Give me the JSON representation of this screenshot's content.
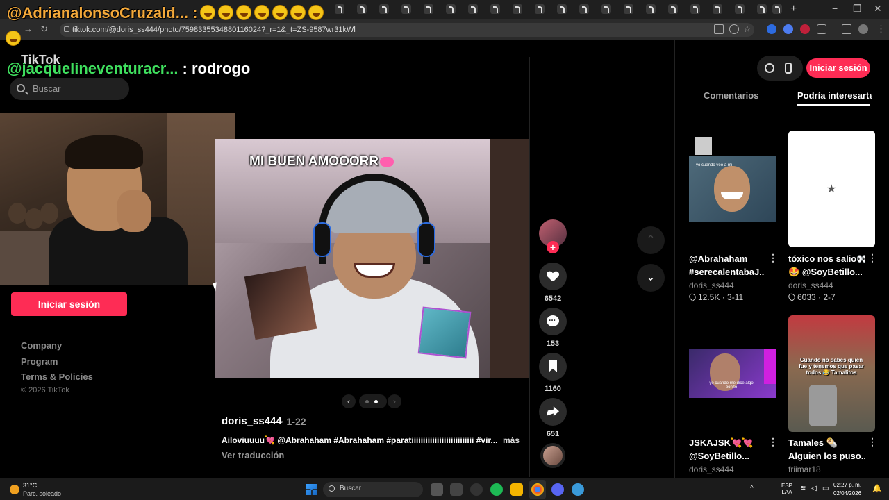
{
  "browser": {
    "url": "tiktok.com/@doris_ss444/photo/7598335534880116024?_r=1&_t=ZS-9587wr31kWl"
  },
  "stream_overlay": {
    "line1_user": "@AdrianalonsoCruzald... :",
    "line2_user": "@jacquelineventuracr...",
    "line2_msg": " : rodrogo"
  },
  "tiktok": {
    "logo": "TikTok",
    "search_placeholder": "Buscar",
    "login_label": "Iniciar sesión",
    "footer_links": [
      "Company",
      "Program",
      "Terms & Policies"
    ],
    "copyright": "© 2026 TikTok"
  },
  "post": {
    "image_caption": "MI BUEN AMOOORR",
    "author": "doris_ss444",
    "date": "· 1-22",
    "description": "Ailoviuuuu💘 @Abrahaham #Abrahaham #paratiiiiiiiiiiiiiiiiiiiiiiiiiii #vir...",
    "more_label": "más",
    "translate_label": "Ver traducción",
    "likes": "6542",
    "comments": "153",
    "saves": "1160",
    "shares": "651"
  },
  "right_panel": {
    "login_label": "Iniciar sesión",
    "tabs": [
      "Comentarios",
      "Podría interesarte"
    ],
    "cards": [
      {
        "title_line1": "@Abrahaham",
        "title_line2": "#serecalentabaJ...",
        "user": "doris_ss444",
        "stats": "12.5K · 3-11",
        "thumb_text": "yo cuando veo a mi"
      },
      {
        "title_line1": "tóxico nos salio👀",
        "title_line2": "🤩 @SoyBetillo...",
        "user": "doris_ss444",
        "stats": "6033 · 2-7",
        "thumb_text": ""
      },
      {
        "title_line1": "JSKAJSK💘💘",
        "title_line2": "@SoyBetillo...",
        "user": "doris_ss444",
        "stats": "",
        "thumb_text": "yo cuando me dice algo bonito"
      },
      {
        "title_line1": "Tamales 🌯",
        "title_line2": "Alguien los puso...",
        "user": "friimar18",
        "stats": "",
        "thumb_text": "Cuando no sabes quien fue y tenemos que pasar todos 😂 Tamalitos"
      }
    ]
  },
  "taskbar": {
    "weather_temp": "31°C",
    "weather_desc": "Parc. soleado",
    "search_placeholder": "Buscar",
    "lang_top": "ESP",
    "lang_bottom": "LAA",
    "time": "02:27 p. m.",
    "date": "02/04/2026"
  },
  "colors": {
    "tiktok_pink": "#fe2c55",
    "overlay_orange": "#f3a83a",
    "overlay_green": "#3fe05e"
  }
}
